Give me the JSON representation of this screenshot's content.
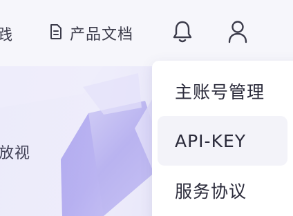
{
  "nav": {
    "partial_item_label": "践",
    "docs_label": "产品文档",
    "docs_icon": "document-icon",
    "bell_icon": "bell-icon",
    "user_icon": "user-icon"
  },
  "hero": {
    "partial_text": "放视"
  },
  "user_menu": {
    "items": [
      {
        "label": "主账号管理"
      },
      {
        "label": "API-KEY"
      },
      {
        "label": "服务协议"
      }
    ]
  },
  "colors": {
    "text": "#3b3b4a",
    "accent_shape": "#a9a2ee",
    "menu_hover": "#f3f3f9"
  }
}
